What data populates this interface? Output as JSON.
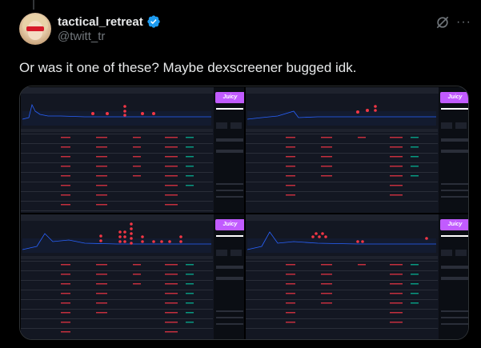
{
  "tweet": {
    "display_name": "tactical_retreat",
    "handle": "@twitt_tr",
    "text": "Or was it one of these? Maybe dexscreener bugged idk.",
    "verified": true
  },
  "icons": {
    "verified": "verified-badge-icon",
    "grok": "grok-icon",
    "more": "more-icon"
  },
  "media": {
    "screens": [
      {
        "id": "top-left",
        "promo_label": "Juicy"
      },
      {
        "id": "top-right",
        "promo_label": "Juicy"
      },
      {
        "id": "bottom-left",
        "promo_label": "Juicy"
      },
      {
        "id": "bottom-right",
        "promo_label": "Juicy"
      }
    ]
  },
  "colors": {
    "background": "#000000",
    "text_primary": "#e7e9ea",
    "text_secondary": "#71767b",
    "verified_blue": "#1d9bf0",
    "chart_bg": "#131722",
    "promo_purple": "#c15bff",
    "sell_red": "#f23645",
    "buy_green": "#089981"
  }
}
